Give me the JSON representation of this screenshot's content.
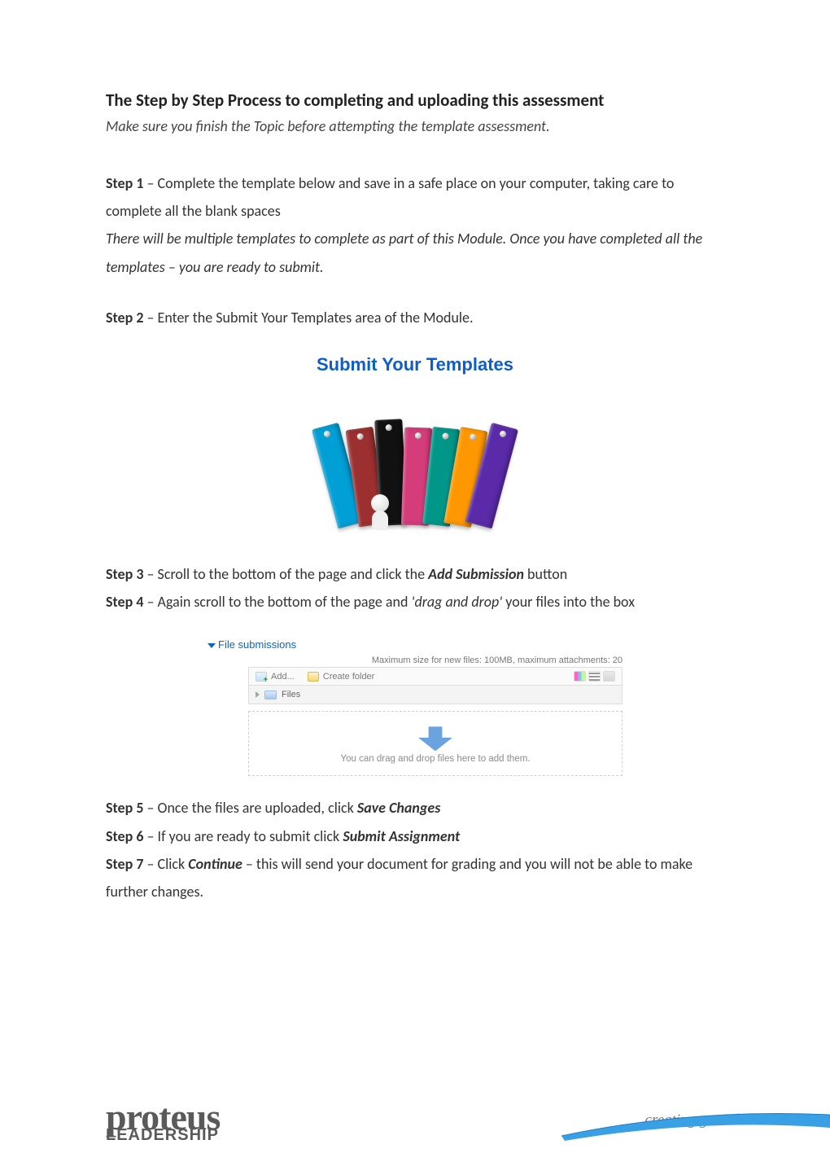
{
  "title": "The Step by Step Process to completing and uploading this assessment",
  "subtitle": "Make sure you finish the Topic before attempting the template assessment.",
  "step1": {
    "label": "Step 1",
    "text_a": " – Complete the template below and save in a safe place on your computer, taking care to complete all the blank spaces",
    "text_b": "There will be multiple templates to complete as part of this Module. Once you have completed all the templates – you are ready to submit."
  },
  "step2": {
    "label": "Step 2",
    "text": " – Enter the Submit Your Templates area of the Module."
  },
  "submit_image": {
    "heading": "Submit Your Templates"
  },
  "step3": {
    "label": "Step 3",
    "text_a": " – Scroll to the bottom of the page and click the ",
    "bold": "Add Submission",
    "text_b": " button"
  },
  "step4": {
    "label": "Step 4",
    "text_a": " – Again scroll to the bottom of the page and ",
    "italic": "'drag and drop'",
    "text_b": " your files into the box"
  },
  "file_submissions": {
    "header": "File submissions",
    "max_size": "Maximum size for new files: 100MB, maximum attachments: 20",
    "add": "Add...",
    "create_folder": "Create folder",
    "files": "Files",
    "dropzone": "You can drag and drop files here to add them."
  },
  "step5": {
    "label": "Step 5",
    "text_a": " – Once the files are uploaded, click ",
    "bold": "Save Changes"
  },
  "step6": {
    "label": "Step 6",
    "text_a": " – If you are ready to submit click ",
    "bold": "Submit Assignment"
  },
  "step7": {
    "label": "Step 7",
    "text_a": " – Click ",
    "bold": "Continue",
    "text_b": " – this will send your document for grading and you will not be able to make further changes."
  },
  "footer": {
    "logo_top": "proteus",
    "logo_bottom": "LEADERSHIP",
    "tagline": "creating great leaders"
  }
}
